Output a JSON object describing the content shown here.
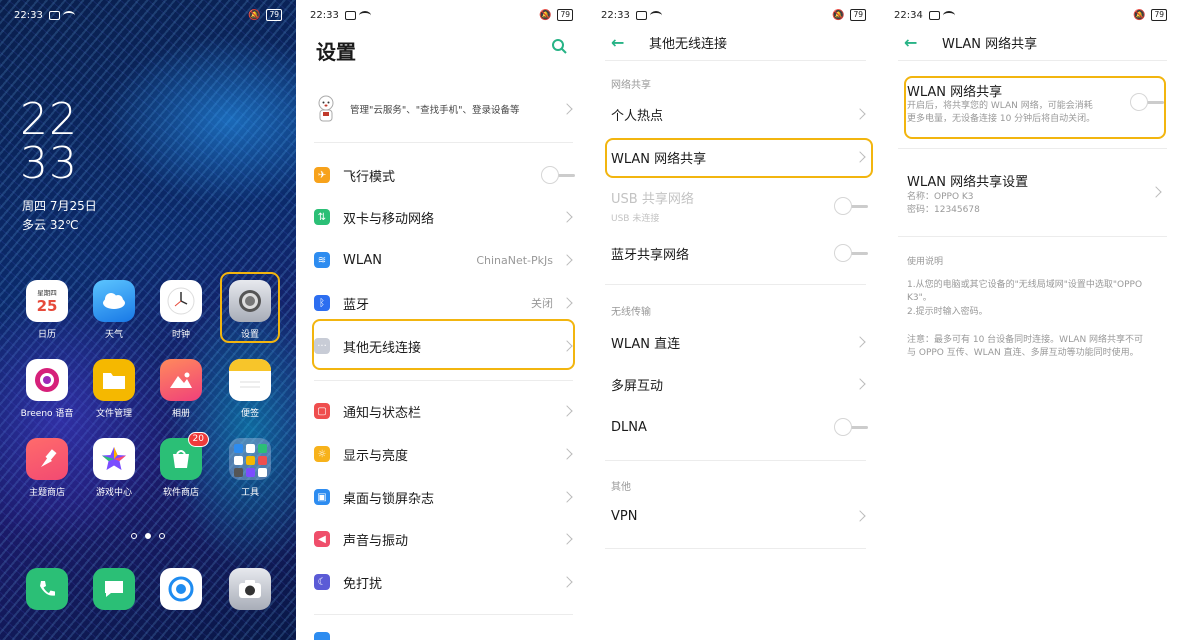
{
  "home": {
    "status_time": "22:33",
    "battery": "79",
    "clock_hour": "22",
    "clock_min": "33",
    "date": "周四  7月25日",
    "weather": "多云 32℃",
    "calendar_weekday": "星期四",
    "calendar_day": "25",
    "apps_row1": [
      "日历",
      "天气",
      "时钟",
      "设置"
    ],
    "apps_row2": [
      "Breeno 语音",
      "文件管理",
      "相册",
      "便签"
    ],
    "apps_row3": [
      "主题商店",
      "游戏中心",
      "软件商店",
      "工具"
    ],
    "store_badge": "20",
    "dock_icons": [
      "phone-icon",
      "messages-icon",
      "browser-icon",
      "camera-icon"
    ]
  },
  "settings": {
    "status_time": "22:33",
    "battery": "79",
    "title": "设置",
    "profile_text": "管理\"云服务\"、\"查找手机\"、登录设备等",
    "items": [
      {
        "label": "飞行模式",
        "icon_color": "#f7a21b",
        "icon": "✈"
      },
      {
        "label": "双卡与移动网络",
        "icon_color": "#2bbf76",
        "icon": "⇅"
      },
      {
        "label": "WLAN",
        "icon_color": "#2d8cf0",
        "icon": "≋",
        "value": "ChinaNet-PkJs"
      },
      {
        "label": "蓝牙",
        "icon_color": "#2d6ef0",
        "icon": "ᛒ",
        "value": "关闭"
      },
      {
        "label": "其他无线连接",
        "icon_color": "#c8ccd6",
        "icon": "···"
      },
      {
        "label": "通知与状态栏",
        "icon_color": "#ef4e4e",
        "icon": "▢"
      },
      {
        "label": "显示与亮度",
        "icon_color": "#f7b21b",
        "icon": "☼"
      },
      {
        "label": "桌面与锁屏杂志",
        "icon_color": "#2d8cf0",
        "icon": "▣"
      },
      {
        "label": "声音与振动",
        "icon_color": "#ef4e6a",
        "icon": "◀"
      },
      {
        "label": "免打扰",
        "icon_color": "#5b5bd6",
        "icon": "☾"
      }
    ]
  },
  "wireless": {
    "status_time": "22:33",
    "battery": "79",
    "title": "其他无线连接",
    "section_share": "网络共享",
    "hotspot": "个人热点",
    "wlan_share": "WLAN 网络共享",
    "usb_share": "USB 共享网络",
    "usb_sub": "USB 未连接",
    "bt_share": "蓝牙共享网络",
    "section_transfer": "无线传输",
    "wlan_direct": "WLAN 直连",
    "multiscreen": "多屏互动",
    "dlna": "DLNA",
    "section_other": "其他",
    "vpn": "VPN"
  },
  "wlanshare": {
    "status_time": "22:34",
    "battery": "79",
    "title": "WLAN 网络共享",
    "toggle_title": "WLAN 网络共享",
    "toggle_desc_1": "开启后，将共享您的 WLAN 网络，可能会消耗",
    "toggle_desc_2": "更多电量，无设备连接 10 分钟后将自动关闭。",
    "settings_title": "WLAN 网络共享设置",
    "name_line": "名称：OPPO K3",
    "pwd_line": "密码：12345678",
    "usage_title": "使用说明",
    "usage_1a": "1.从您的电脑或其它设备的\"无线局域网\"设置中选取\"OPPO",
    "usage_1b": "K3\"。",
    "usage_2": "2.提示时输入密码。",
    "note_1": "注意：最多可有 10 台设备同时连接。WLAN 网络共享不可",
    "note_2": "与 OPPO 互传、WLAN 直连、多屏互动等功能同时使用。"
  },
  "colors": {
    "accent": "#27b386",
    "highlight": "#f2b50f"
  }
}
